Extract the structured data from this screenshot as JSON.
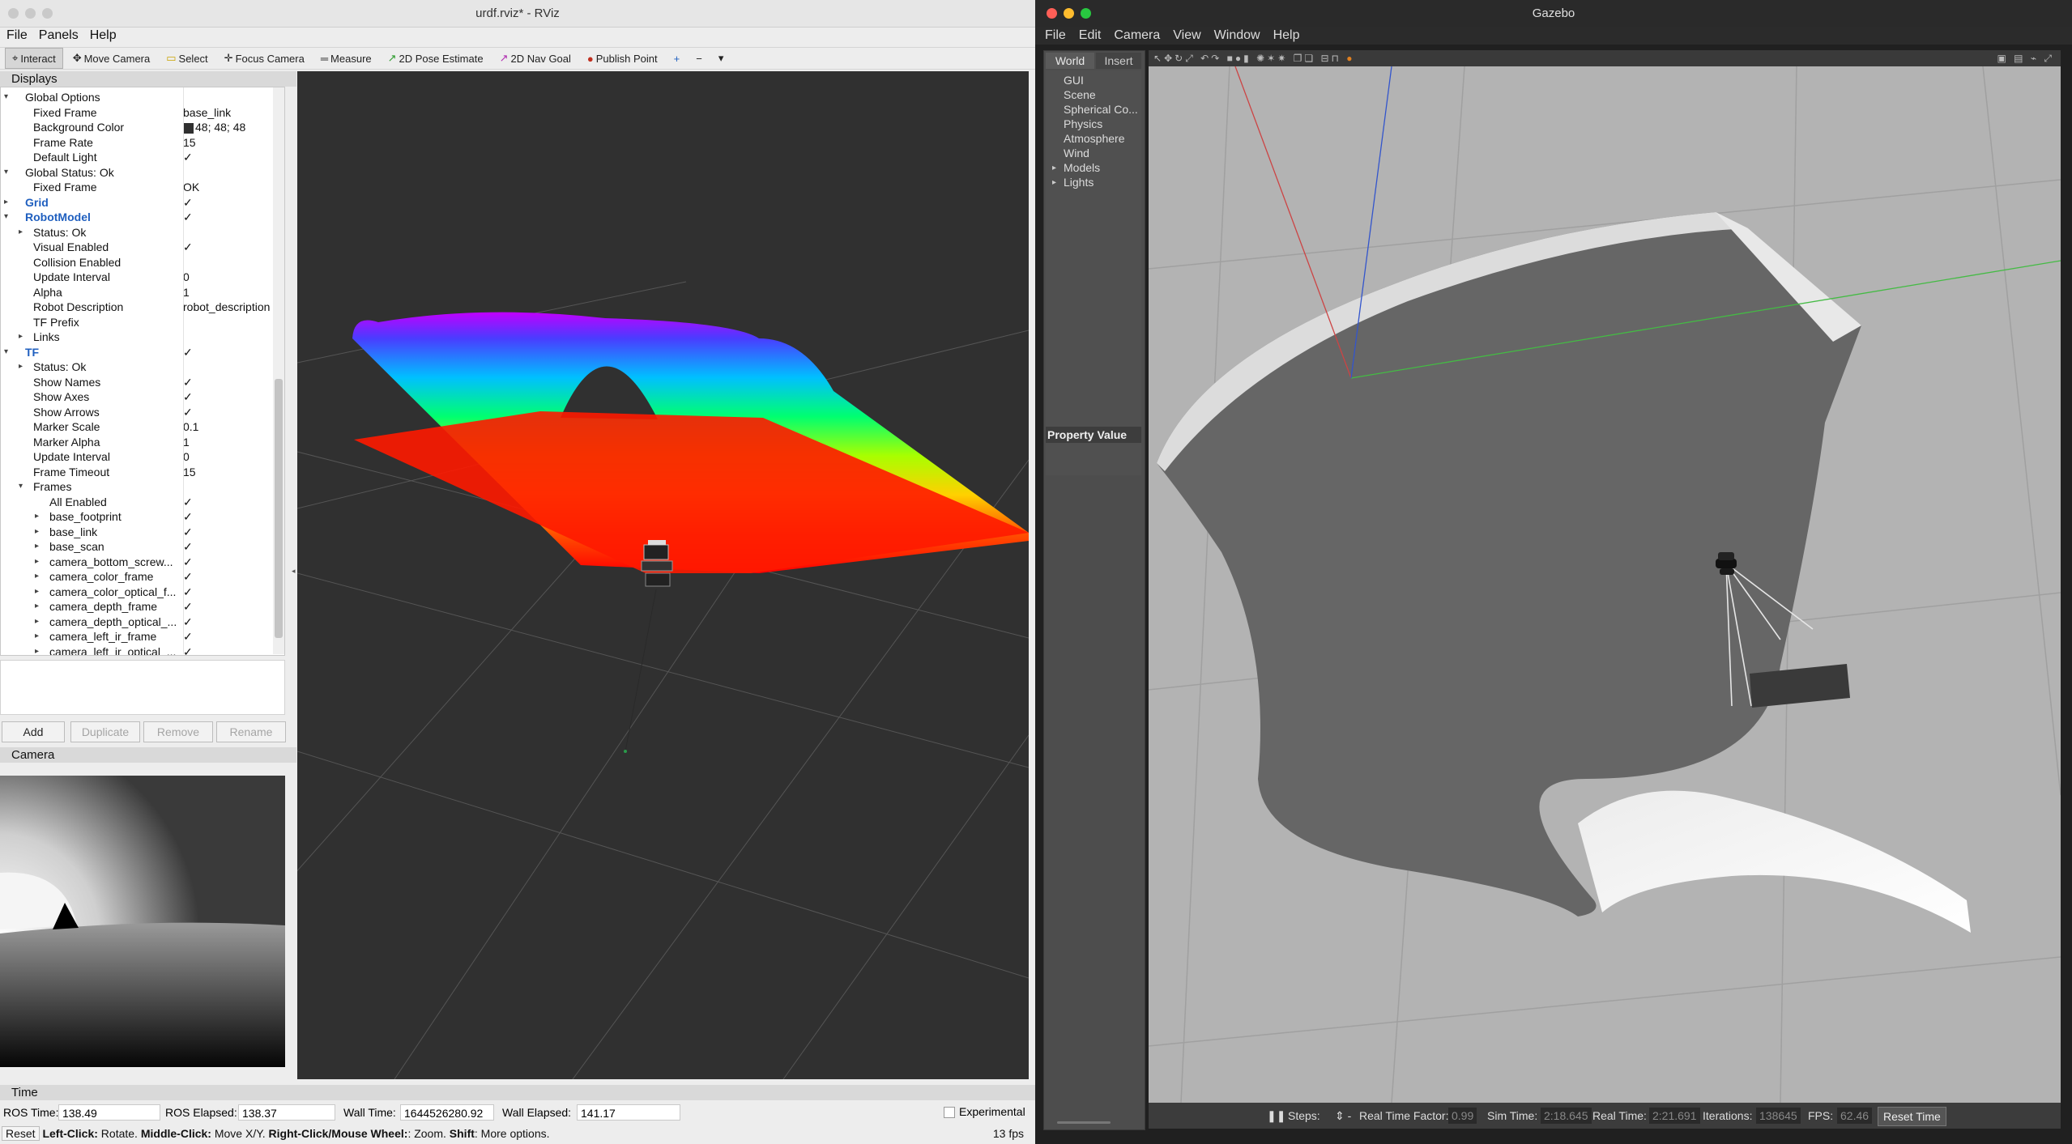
{
  "rviz": {
    "window_title": "urdf.rviz* - RViz",
    "menu": [
      "File",
      "Panels",
      "Help"
    ],
    "toolbar": [
      "Interact",
      "Move Camera",
      "Select",
      "Focus Camera",
      "Measure",
      "2D Pose Estimate",
      "2D Nav Goal",
      "Publish Point"
    ],
    "displays_title": "Displays",
    "properties": [
      {
        "k": "Global Options",
        "v": "",
        "indent": 1,
        "arrow": "▾",
        "chk": false
      },
      {
        "k": "Fixed Frame",
        "v": "base_link",
        "indent": 2,
        "arrow": "",
        "chk": false
      },
      {
        "k": "Background Color",
        "v": "48; 48; 48",
        "indent": 2,
        "arrow": "",
        "chk": false,
        "swatch": true
      },
      {
        "k": "Frame Rate",
        "v": "15",
        "indent": 2,
        "arrow": "",
        "chk": false
      },
      {
        "k": "Default Light",
        "v": "✓",
        "indent": 2,
        "arrow": "",
        "chk": false
      },
      {
        "k": "Global Status: Ok",
        "v": "",
        "indent": 1,
        "arrow": "▾",
        "chk": false
      },
      {
        "k": "Fixed Frame",
        "v": "OK",
        "indent": 2,
        "arrow": "",
        "chk": false
      },
      {
        "k": "Grid",
        "v": "✓",
        "indent": 1,
        "arrow": "▸",
        "chk": false,
        "blue": true
      },
      {
        "k": "RobotModel",
        "v": "✓",
        "indent": 1,
        "arrow": "▾",
        "chk": false,
        "blue": true
      },
      {
        "k": "Status: Ok",
        "v": "",
        "indent": 2,
        "arrow": "▸",
        "chk": false
      },
      {
        "k": "Visual Enabled",
        "v": "✓",
        "indent": 2,
        "arrow": "",
        "chk": false
      },
      {
        "k": "Collision Enabled",
        "v": "",
        "indent": 2,
        "arrow": "",
        "chk": false
      },
      {
        "k": "Update Interval",
        "v": "0",
        "indent": 2,
        "arrow": "",
        "chk": false
      },
      {
        "k": "Alpha",
        "v": "1",
        "indent": 2,
        "arrow": "",
        "chk": false
      },
      {
        "k": "Robot Description",
        "v": "robot_description",
        "indent": 2,
        "arrow": "",
        "chk": false
      },
      {
        "k": "TF Prefix",
        "v": "",
        "indent": 2,
        "arrow": "",
        "chk": false
      },
      {
        "k": "Links",
        "v": "",
        "indent": 2,
        "arrow": "▸",
        "chk": false
      },
      {
        "k": "TF",
        "v": "✓",
        "indent": 1,
        "arrow": "▾",
        "chk": false,
        "blue": true
      },
      {
        "k": "Status: Ok",
        "v": "",
        "indent": 2,
        "arrow": "▸",
        "chk": false
      },
      {
        "k": "Show Names",
        "v": "✓",
        "indent": 2,
        "arrow": "",
        "chk": false
      },
      {
        "k": "Show Axes",
        "v": "✓",
        "indent": 2,
        "arrow": "",
        "chk": false
      },
      {
        "k": "Show Arrows",
        "v": "✓",
        "indent": 2,
        "arrow": "",
        "chk": false
      },
      {
        "k": "Marker Scale",
        "v": "0.1",
        "indent": 2,
        "arrow": "",
        "chk": false
      },
      {
        "k": "Marker Alpha",
        "v": "1",
        "indent": 2,
        "arrow": "",
        "chk": false
      },
      {
        "k": "Update Interval",
        "v": "0",
        "indent": 2,
        "arrow": "",
        "chk": false
      },
      {
        "k": "Frame Timeout",
        "v": "15",
        "indent": 2,
        "arrow": "",
        "chk": false
      },
      {
        "k": "Frames",
        "v": "",
        "indent": 2,
        "arrow": "▾",
        "chk": false
      },
      {
        "k": "All Enabled",
        "v": "✓",
        "indent": 3,
        "arrow": "",
        "chk": false
      },
      {
        "k": "base_footprint",
        "v": "✓",
        "indent": 3,
        "arrow": "▸",
        "chk": false
      },
      {
        "k": "base_link",
        "v": "✓",
        "indent": 3,
        "arrow": "▸",
        "chk": false
      },
      {
        "k": "base_scan",
        "v": "✓",
        "indent": 3,
        "arrow": "▸",
        "chk": false
      },
      {
        "k": "camera_bottom_screw...",
        "v": "✓",
        "indent": 3,
        "arrow": "▸",
        "chk": false
      },
      {
        "k": "camera_color_frame",
        "v": "✓",
        "indent": 3,
        "arrow": "▸",
        "chk": false
      },
      {
        "k": "camera_color_optical_f...",
        "v": "✓",
        "indent": 3,
        "arrow": "▸",
        "chk": false
      },
      {
        "k": "camera_depth_frame",
        "v": "✓",
        "indent": 3,
        "arrow": "▸",
        "chk": false
      },
      {
        "k": "camera_depth_optical_...",
        "v": "✓",
        "indent": 3,
        "arrow": "▸",
        "chk": false
      },
      {
        "k": "camera_left_ir_frame",
        "v": "✓",
        "indent": 3,
        "arrow": "▸",
        "chk": false
      },
      {
        "k": "camera_left_ir_optical_...",
        "v": "✓",
        "indent": 3,
        "arrow": "▸",
        "chk": false
      }
    ],
    "buttons": {
      "add": "Add",
      "duplicate": "Duplicate",
      "remove": "Remove",
      "rename": "Rename"
    },
    "camera_title": "Camera",
    "time_title": "Time",
    "time": {
      "ros_time_label": "ROS Time:",
      "ros_time": "138.49",
      "ros_elapsed_label": "ROS Elapsed:",
      "ros_elapsed": "138.37",
      "wall_time_label": "Wall Time:",
      "wall_time": "1644526280.92",
      "wall_elapsed_label": "Wall Elapsed:",
      "wall_elapsed": "141.17",
      "experimental": "Experimental"
    },
    "status": {
      "reset": "Reset",
      "left_click": "Left-Click:",
      "left_desc": " Rotate. ",
      "middle_click": "Middle-Click:",
      "middle_desc": " Move X/Y. ",
      "right_click": "Right-Click/Mouse Wheel:",
      "right_desc": ": Zoom. ",
      "shift": "Shift",
      "shift_desc": ": More options.",
      "fps": "13 fps"
    },
    "colors": {
      "viewport_bg": "#303030",
      "accent_blue": "#1f5fbf"
    }
  },
  "gazebo": {
    "window_title": "Gazebo",
    "menu": [
      "File",
      "Edit",
      "Camera",
      "View",
      "Window",
      "Help"
    ],
    "tabs": [
      "World",
      "Insert"
    ],
    "tree": [
      "GUI",
      "Scene",
      "Spherical Co...",
      "Physics",
      "Atmosphere",
      "Wind",
      "Models",
      "Lights"
    ],
    "property_value": "Property Value",
    "bottom": {
      "steps": "Steps: ",
      "rtf_label": "Real Time Factor:",
      "rtf": "0.99",
      "sim_label": "Sim Time:",
      "sim": "2:18.645",
      "real_label": "Real Time:",
      "real": "2:21.691",
      "iter_label": "Iterations:",
      "iter": "138645",
      "fps_label": "FPS:",
      "fps": "62.46",
      "reset": "Reset Time"
    }
  }
}
